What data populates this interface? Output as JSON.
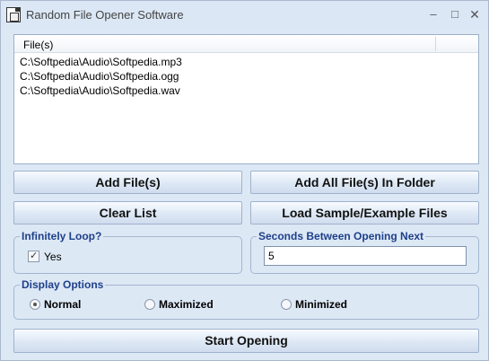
{
  "window": {
    "title": "Random File Opener Software",
    "minimize_glyph": "–",
    "maximize_glyph": "□",
    "close_glyph": "✕"
  },
  "file_list": {
    "column_header": "File(s)",
    "files": [
      "C:\\Softpedia\\Audio\\Softpedia.mp3",
      "C:\\Softpedia\\Audio\\Softpedia.ogg",
      "C:\\Softpedia\\Audio\\Softpedia.wav"
    ]
  },
  "buttons": {
    "add_files": "Add File(s)",
    "add_all_in_folder": "Add All File(s) In Folder",
    "clear_list": "Clear List",
    "load_sample": "Load Sample/Example Files",
    "start_opening": "Start Opening"
  },
  "infinite_loop": {
    "legend": "Infinitely Loop?",
    "checkbox_label": "Yes",
    "checked": true
  },
  "seconds_between": {
    "legend": "Seconds Between Opening Next",
    "value": "5"
  },
  "display_options": {
    "legend": "Display Options",
    "options": [
      "Normal",
      "Maximized",
      "Minimized"
    ],
    "selected": "Normal"
  },
  "icons": {
    "app": "app-window-icon",
    "check": "✓"
  }
}
